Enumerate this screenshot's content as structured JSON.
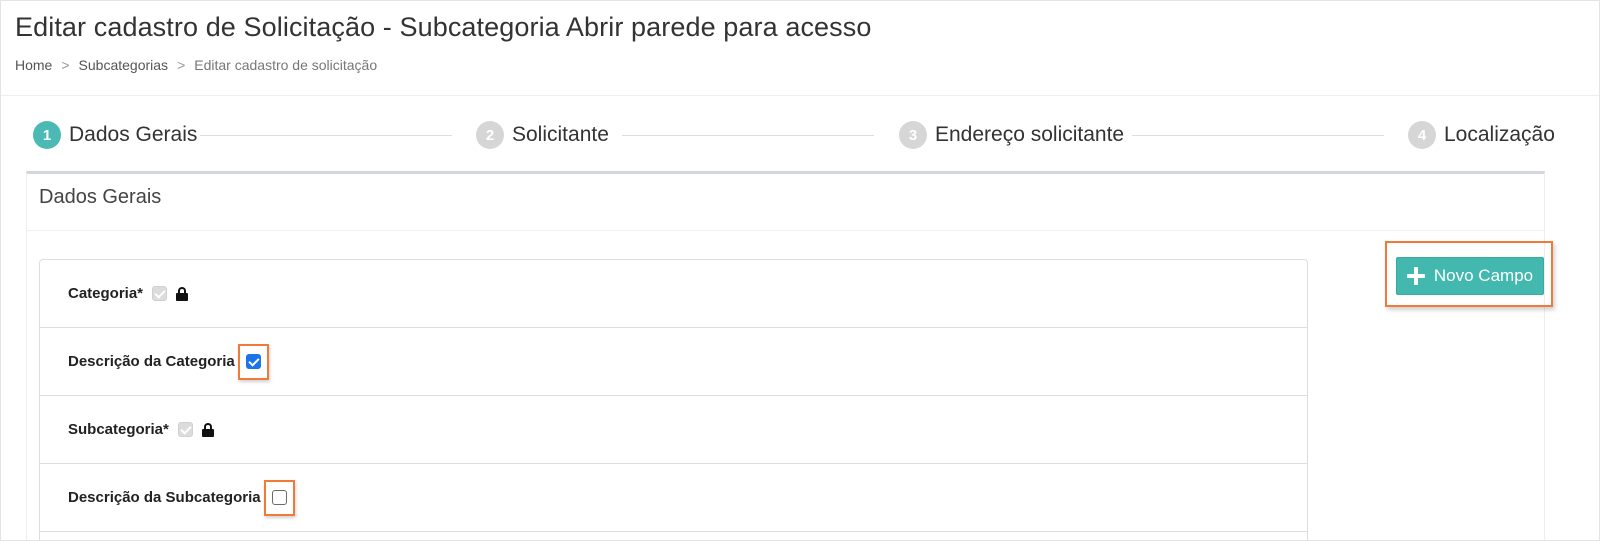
{
  "header": {
    "title": "Editar cadastro de Solicitação - Subcategoria Abrir parede para acesso",
    "breadcrumb": [
      {
        "label": "Home"
      },
      {
        "label": "Subcategorias"
      },
      {
        "label": "Editar cadastro de solicitação"
      }
    ],
    "breadcrumb_separator": ">"
  },
  "stepper": {
    "steps": [
      {
        "number": "1",
        "label": "Dados Gerais",
        "active": true
      },
      {
        "number": "2",
        "label": "Solicitante",
        "active": false
      },
      {
        "number": "3",
        "label": "Endereço solicitante",
        "active": false
      },
      {
        "number": "4",
        "label": "Localização",
        "active": false
      }
    ]
  },
  "card": {
    "title": "Dados Gerais",
    "fields": [
      {
        "label": "Categoria*",
        "state": "checked-disabled",
        "locked": true
      },
      {
        "label": "Descrição da Categoria",
        "state": "checked",
        "locked": false
      },
      {
        "label": "Subcategoria*",
        "state": "checked-disabled",
        "locked": true
      },
      {
        "label": "Descrição da Subcategoria",
        "state": "unchecked",
        "locked": false
      }
    ]
  },
  "actions": {
    "new_field_label": "Novo Campo",
    "new_field_icon": "plus-icon"
  },
  "colors": {
    "accent": "#42b8ae",
    "step_active": "#4cbab4",
    "step_inactive": "#d6d6d6",
    "highlight": "#f07a3a",
    "checkbox_checked": "#1a73e8"
  }
}
